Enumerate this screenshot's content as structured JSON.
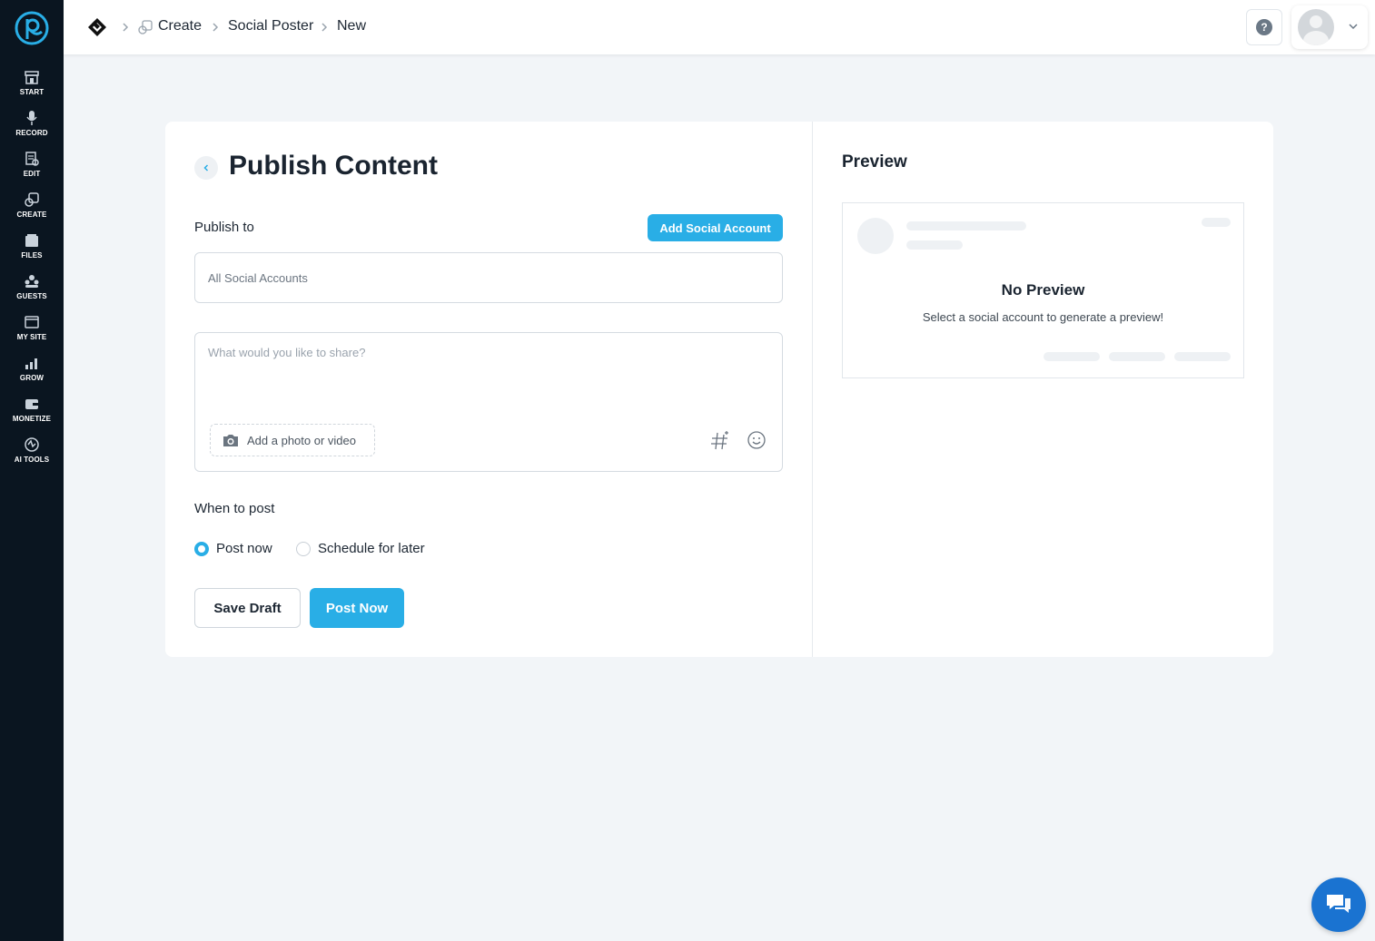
{
  "sidebar": {
    "items": [
      {
        "label": "START",
        "icon": "storefront-icon"
      },
      {
        "label": "RECORD",
        "icon": "microphone-icon"
      },
      {
        "label": "EDIT",
        "icon": "edit-icon"
      },
      {
        "label": "CREATE",
        "icon": "create-icon"
      },
      {
        "label": "FILES",
        "icon": "files-icon"
      },
      {
        "label": "GUESTS",
        "icon": "guests-icon"
      },
      {
        "label": "MY SITE",
        "icon": "site-icon"
      },
      {
        "label": "GROW",
        "icon": "chart-icon"
      },
      {
        "label": "MONETIZE",
        "icon": "wallet-icon"
      },
      {
        "label": "AI TOOLS",
        "icon": "ai-icon"
      }
    ]
  },
  "breadcrumb": {
    "items": [
      "Create",
      "Social Poster",
      "New"
    ]
  },
  "page": {
    "title": "Publish Content",
    "publish_to_label": "Publish to",
    "add_account_label": "Add Social Account",
    "accounts_select_value": "All Social Accounts",
    "composer_placeholder": "What would you like to share?",
    "media_button_label": "Add a photo or video",
    "when_label": "When to post",
    "options": [
      {
        "label": "Post now",
        "selected": true
      },
      {
        "label": "Schedule for later",
        "selected": false
      }
    ],
    "save_draft_label": "Save Draft",
    "post_now_label": "Post Now"
  },
  "preview": {
    "title": "Preview",
    "empty_title": "No Preview",
    "empty_subtitle": "Select a social account to generate a preview!"
  },
  "colors": {
    "sidebar_bg": "#0a1520",
    "accent": "#29aee6",
    "chat_fab": "#1a73d1",
    "page_bg": "#f2f5f8"
  }
}
